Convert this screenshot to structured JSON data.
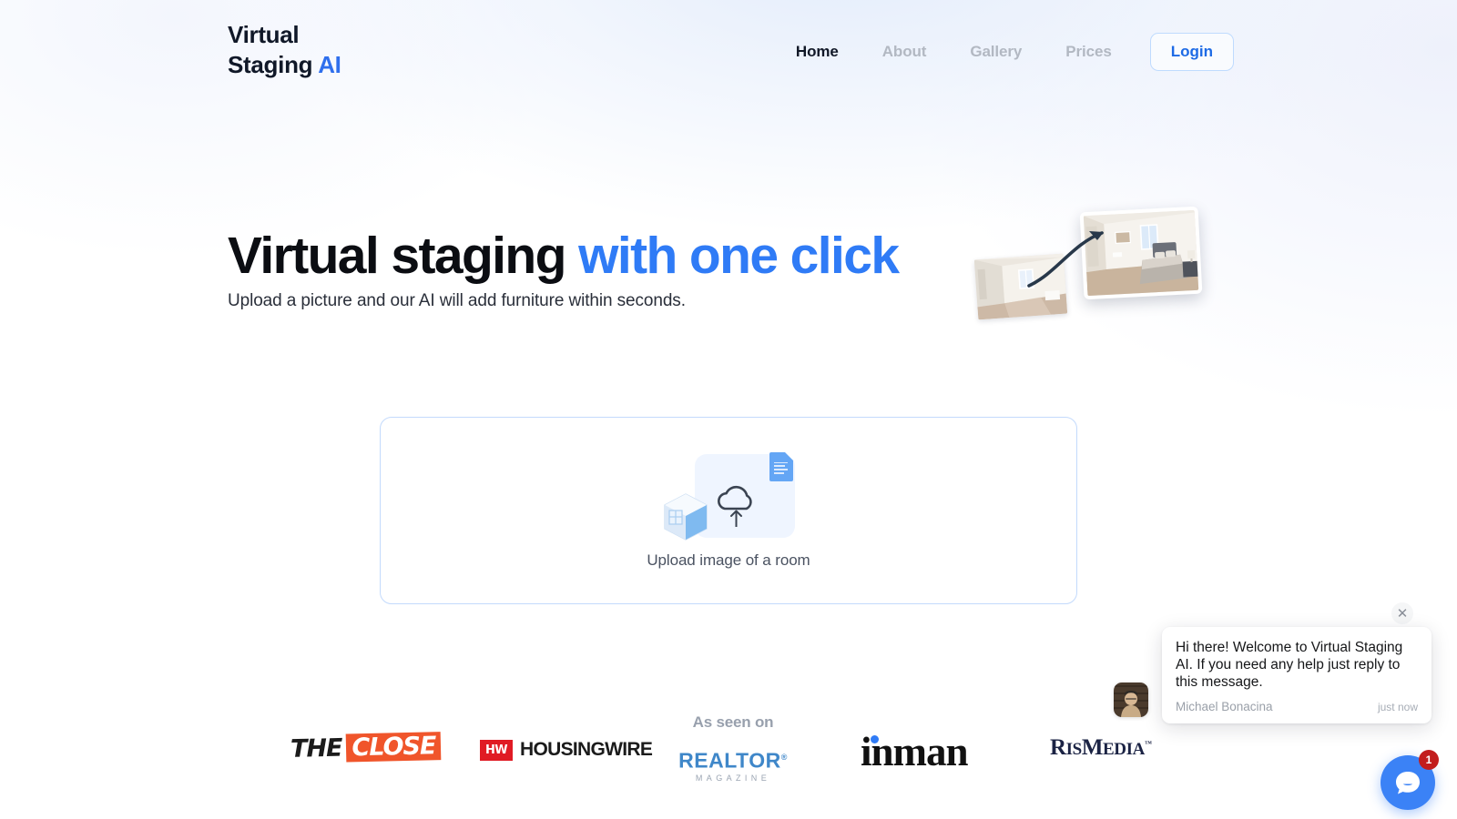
{
  "header": {
    "logo_line1": "Virtual",
    "logo_line2": "Staging ",
    "logo_accent": "AI",
    "nav": [
      {
        "label": "Home",
        "active": true
      },
      {
        "label": "About",
        "active": false
      },
      {
        "label": "Gallery",
        "active": false
      },
      {
        "label": "Prices",
        "active": false
      }
    ],
    "login_label": "Login"
  },
  "hero": {
    "title_plain": "Virtual staging ",
    "title_accent": "with one click",
    "subtitle": "Upload a picture and our AI will add furniture within seconds.",
    "art": {
      "before_alt": "empty room photo",
      "after_alt": "virtually staged bedroom photo",
      "arrow": "curved-arrow-icon"
    }
  },
  "upload": {
    "label": "Upload image of a room",
    "icons": {
      "cloud": "cloud-upload-icon",
      "document": "document-icon",
      "cube": "room-cube-icon"
    }
  },
  "press": {
    "as_seen_on": "As seen on",
    "logos": [
      {
        "name": "the-close",
        "word1": "THE",
        "word2": "CLOSE"
      },
      {
        "name": "housingwire",
        "badge": "HW",
        "word": "HOUSINGWIRE"
      },
      {
        "name": "realtor-magazine",
        "word": "REALTOR",
        "trademark": "®",
        "sub": "MAGAZINE"
      },
      {
        "name": "inman",
        "word": "inman"
      },
      {
        "name": "rismedia",
        "word_r": "R",
        "word_is": "IS",
        "word_m": "M",
        "word_edia": "EDIA",
        "trademark": "™"
      }
    ]
  },
  "chat": {
    "message": "Hi there! Welcome to Virtual Staging AI. If you need any help just reply to this message.",
    "author": "Michael Bonacina",
    "time": "just now",
    "close_icon": "close-icon",
    "launcher_icon": "chat-bubble-icon",
    "unread_count": "1"
  },
  "colors": {
    "accent_blue": "#2f7bf6",
    "login_blue": "#1d6ae5",
    "dropzone_border": "#c3dafc",
    "close_orange": "#f0552b",
    "hw_red": "#e01b24",
    "realtor_blue": "#3f87c9",
    "rismedia_navy": "#1b2344",
    "badge_red": "#c21d1d",
    "launcher_blue": "#3b82f6"
  }
}
